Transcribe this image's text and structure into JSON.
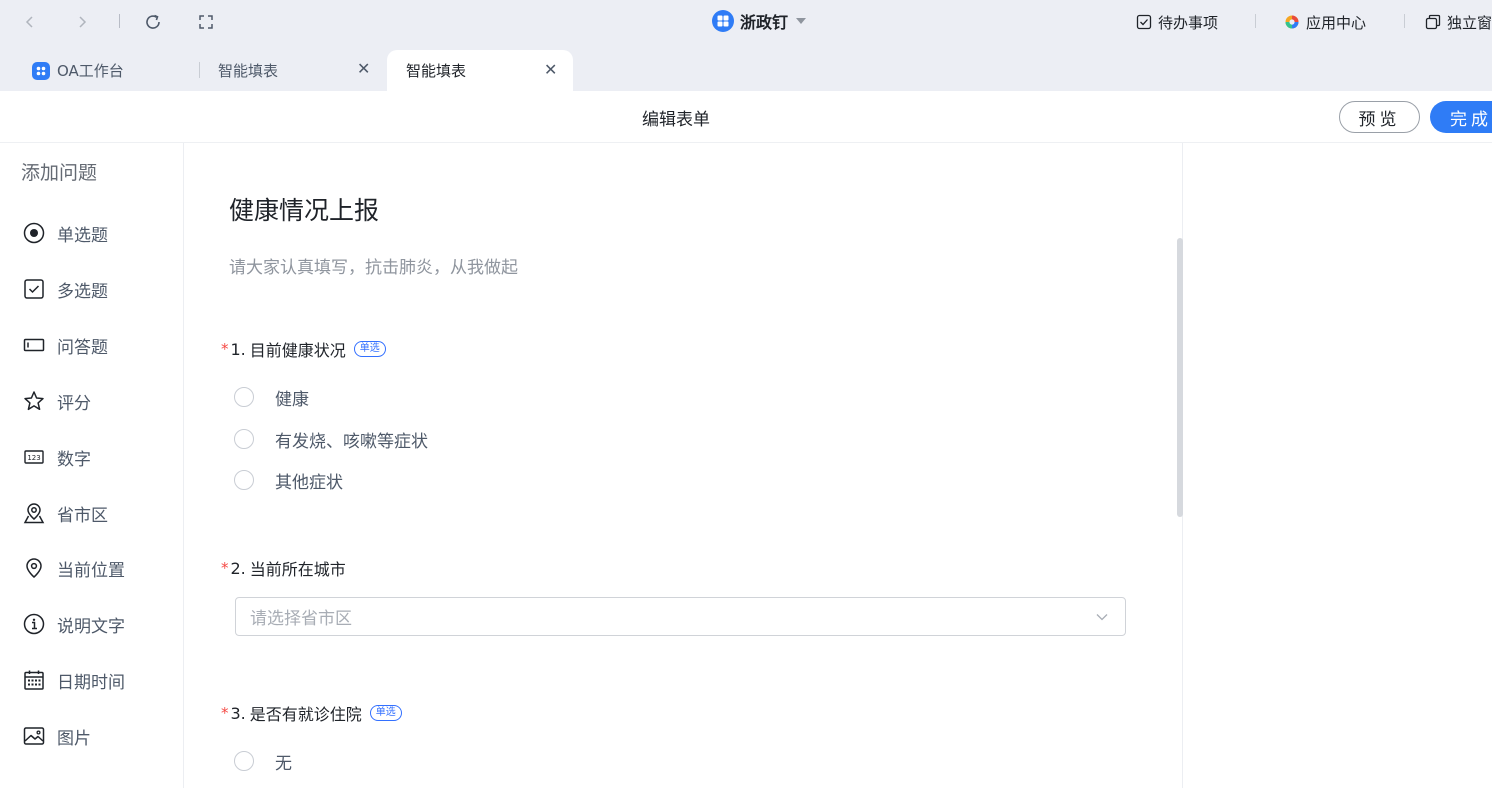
{
  "app": {
    "brand": "浙政钉",
    "top_links": [
      {
        "label": "待办事项"
      },
      {
        "label": "应用中心"
      },
      {
        "label": "独立窗"
      }
    ]
  },
  "tabs": [
    {
      "label": "OA工作台"
    },
    {
      "label": "智能填表"
    },
    {
      "label": "智能填表"
    }
  ],
  "editor": {
    "title": "编辑表单",
    "preview_label": "预览",
    "done_label": "完成"
  },
  "palette": {
    "title": "添加问题",
    "items": [
      {
        "label": "单选题",
        "icon": "radio-icon"
      },
      {
        "label": "多选题",
        "icon": "checkbox-icon"
      },
      {
        "label": "问答题",
        "icon": "textbox-icon"
      },
      {
        "label": "评分",
        "icon": "star-icon"
      },
      {
        "label": "数字",
        "icon": "number-icon"
      },
      {
        "label": "省市区",
        "icon": "region-icon"
      },
      {
        "label": "当前位置",
        "icon": "location-icon"
      },
      {
        "label": "说明文字",
        "icon": "info-icon"
      },
      {
        "label": "日期时间",
        "icon": "calendar-icon"
      },
      {
        "label": "图片",
        "icon": "image-icon"
      }
    ]
  },
  "form": {
    "title": "健康情况上报",
    "description": "请大家认真填写，抗击肺炎，从我做起",
    "questions": [
      {
        "number": "1.",
        "title": "目前健康状况",
        "tag": "单选",
        "options": [
          "健康",
          "有发烧、咳嗽等症状",
          "其他症状"
        ]
      },
      {
        "number": "2.",
        "title": "当前所在城市",
        "placeholder": "请选择省市区"
      },
      {
        "number": "3.",
        "title": "是否有就诊住院",
        "tag": "单选",
        "options": [
          "无"
        ]
      }
    ],
    "required_mark": "*"
  },
  "colors": {
    "accent": "#2f7cf6",
    "required": "#f54a45",
    "tag": "#3370ff"
  }
}
